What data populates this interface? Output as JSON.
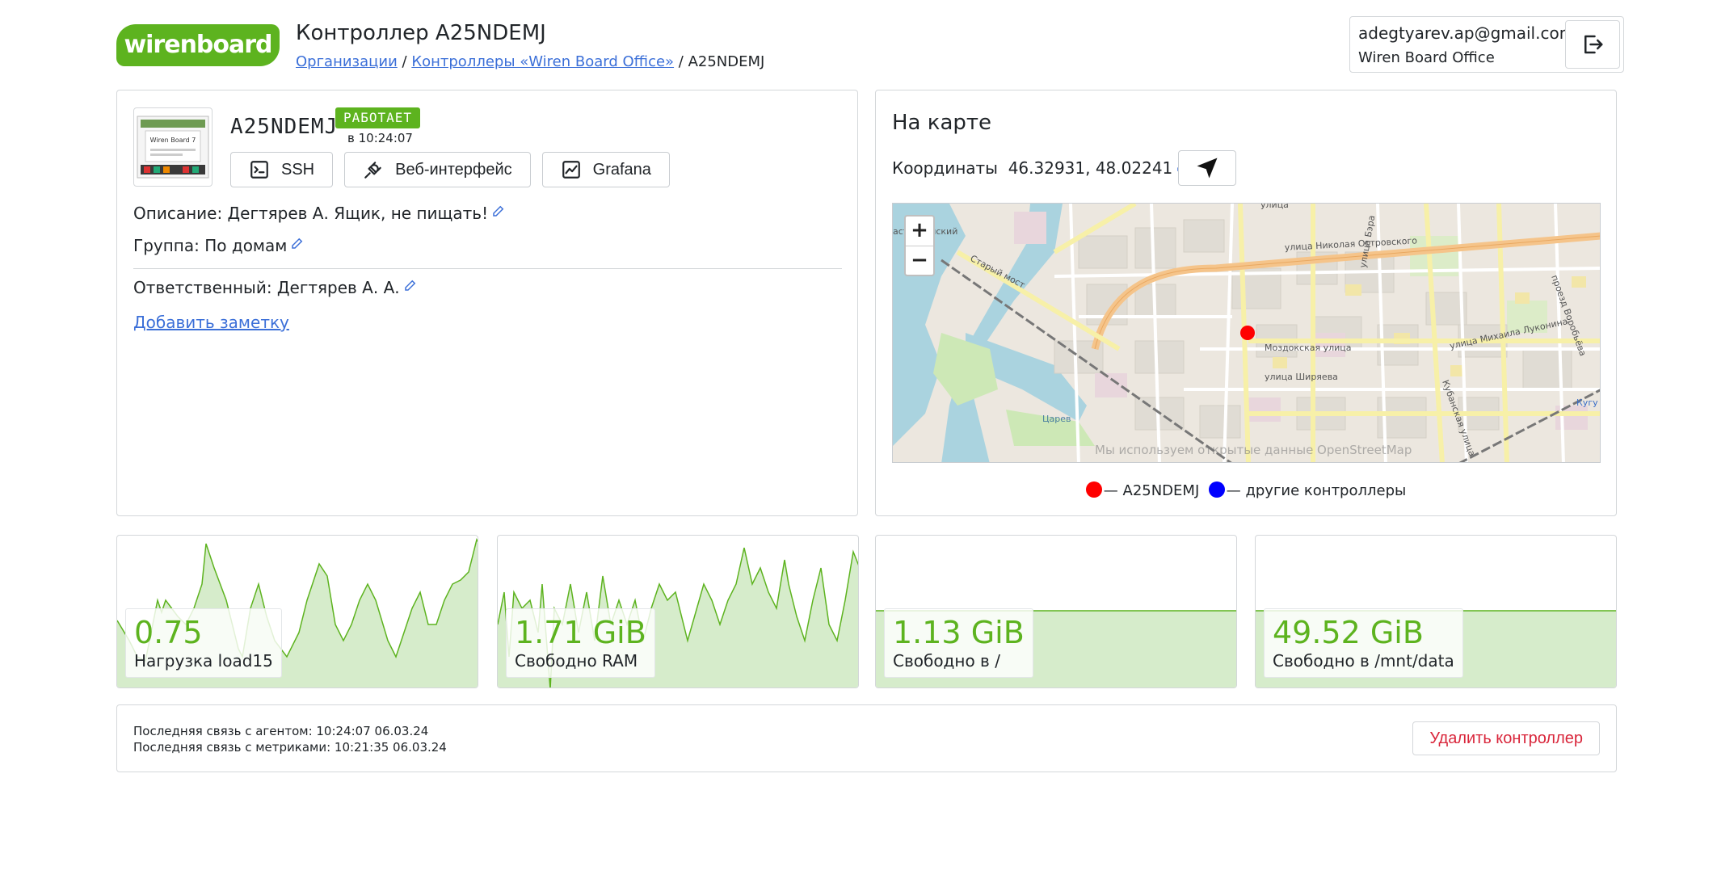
{
  "header": {
    "logo_text": "wirenboard",
    "title": "Контроллер A25NDEMJ",
    "breadcrumb": {
      "organizations": "Организации",
      "sep1": " / ",
      "controllers": "Контроллеры «Wiren Board Office»",
      "sep2": " / ",
      "current": "A25NDEMJ"
    },
    "user": {
      "email": "adegtyarev.ap@gmail.com",
      "org": "Wiren Board Office"
    }
  },
  "controller": {
    "thumb_text": "Wiren Board 7",
    "name": "A25NDEMJ",
    "status": "РАБОТАЕТ",
    "status_time": "в 10:24:07",
    "buttons": {
      "ssh": "SSH",
      "web": "Веб-интерфейс",
      "grafana": "Grafana"
    },
    "description": "Описание: Дегтярев А. Ящик, не пищать!",
    "group": "Группа: По домам",
    "responsible": "Ответственный: Дегтярев А. А.",
    "add_note": "Добавить заметку"
  },
  "map": {
    "title": "На карте",
    "coords_label": "Координаты",
    "coords_value": "46.32931, 48.02241",
    "zoom_in": "+",
    "zoom_out": "−",
    "streets": {
      "s1": "улица Николая Островского",
      "s2": "Моздокская улица",
      "s3": "улица Ширяева",
      "s4": "улица Михаила Луконина",
      "s5": "Кубанская улица",
      "s6": "Старый мост",
      "s7": "Царев",
      "s8": "улица Бэра",
      "s9": "проезд Воробьёва",
      "s10": "Кугу",
      "s11": "улица",
      "s12": "астраханский"
    },
    "attribution": "Мы используем открытые данные OpenStreetMap",
    "legend": {
      "self": "— A25NDEMJ",
      "others": "— другие контроллеры",
      "self_color": "#ff0000",
      "others_color": "#0000ff"
    }
  },
  "metrics": [
    {
      "value": "0.75",
      "label": "Нагрузка load15"
    },
    {
      "value": "1.71 GiB",
      "label": "Свободно RAM"
    },
    {
      "value": "1.13 GiB",
      "label": "Свободно в /"
    },
    {
      "value": "49.52 GiB",
      "label": "Свободно в /mnt/data"
    }
  ],
  "footer": {
    "agent": "Последняя связь с агентом: 10:24:07 06.03.24",
    "metrics": "Последняя связь с метриками: 10:21:35 06.03.24",
    "delete": "Удалить контроллер"
  },
  "colors": {
    "brand": "#5db31f",
    "link": "#3b6fd8",
    "danger": "#d9263b",
    "chart_fill": "#d6eccb"
  }
}
